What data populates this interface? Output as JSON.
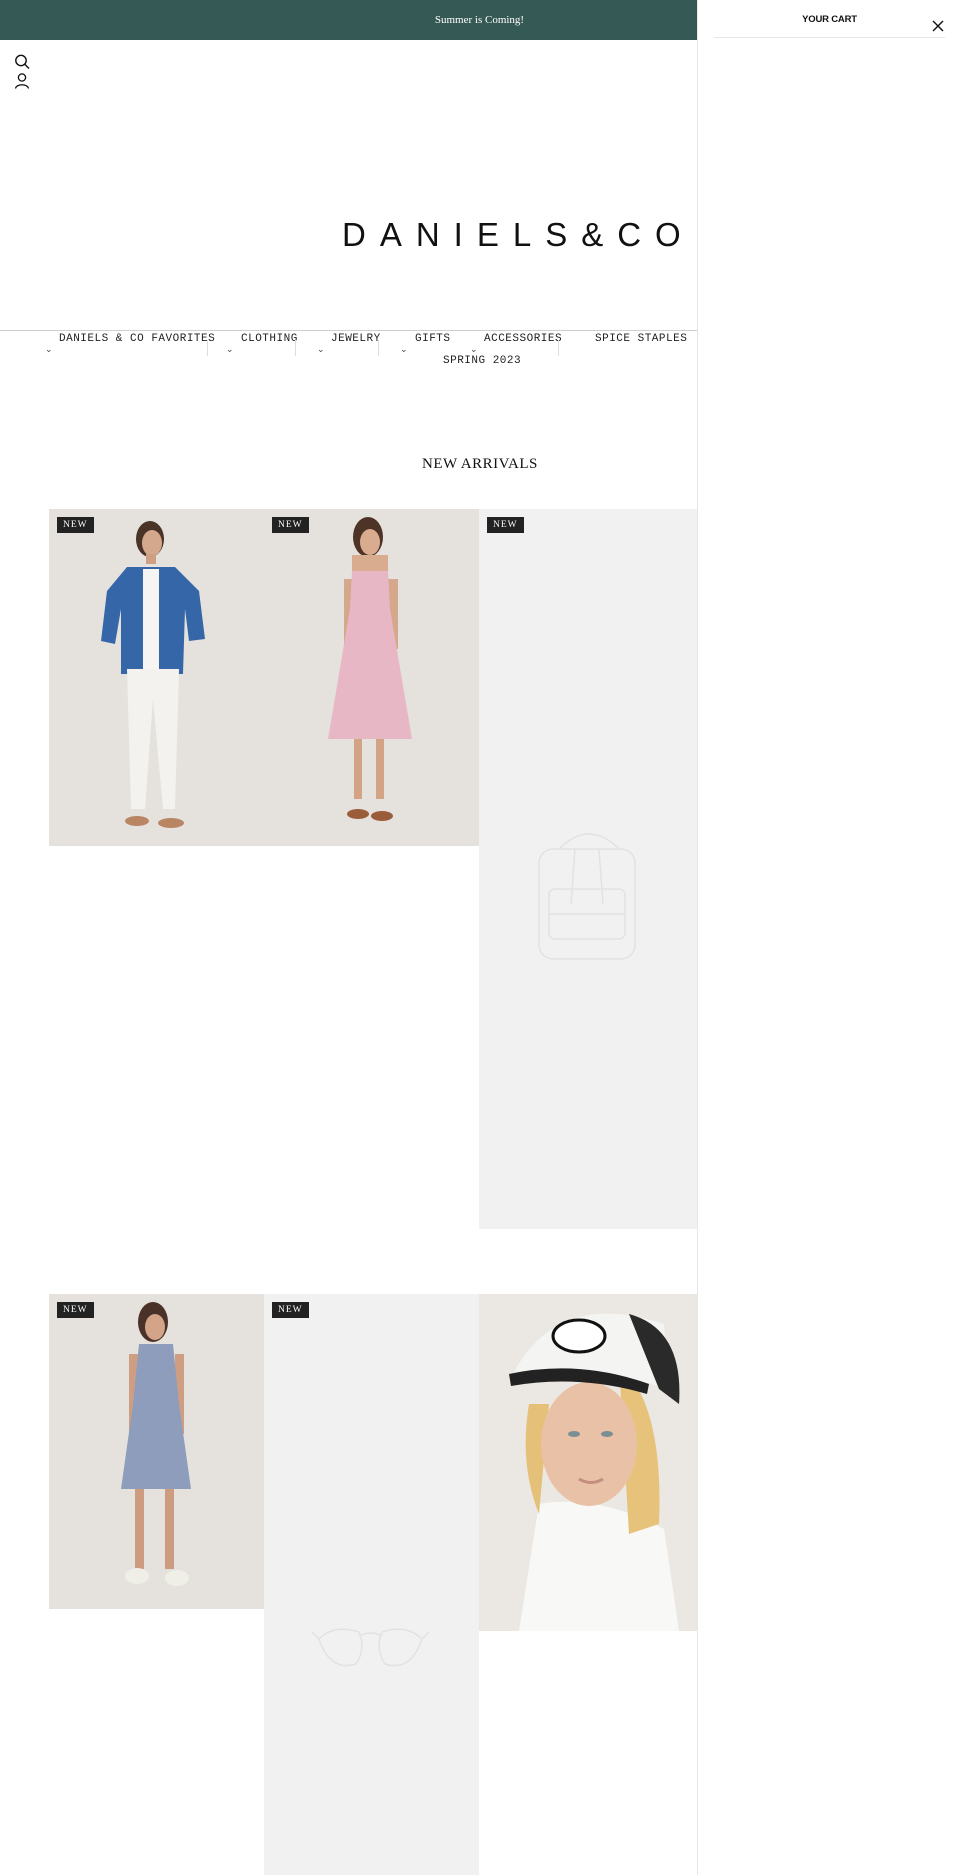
{
  "announcement": "Summer is Coming!",
  "logo": "DANIELS&CO",
  "header_icons": [
    "search-icon",
    "account-icon"
  ],
  "nav": [
    {
      "label": "DANIELS & CO FAVORITES",
      "has_dropdown": true
    },
    {
      "label": "CLOTHING",
      "has_dropdown": true
    },
    {
      "label": "JEWELRY",
      "has_dropdown": true
    },
    {
      "label": "GIFTS",
      "has_dropdown": true
    },
    {
      "label": "ACCESSORIES",
      "has_dropdown": true
    },
    {
      "label": "SPICE STAPLES",
      "has_dropdown": false
    },
    {
      "label": "SPRING 2023",
      "has_dropdown": false
    }
  ],
  "section_title": "NEW ARRIVALS",
  "badge_label": "NEW",
  "products": [
    {
      "image": "woman-blue-shirt-white-pants",
      "badge": true
    },
    {
      "image": "woman-pink-midi-dress",
      "badge": true
    },
    {
      "image": "placeholder-backpack-icon",
      "badge": true
    },
    {
      "image": "woman-blue-grey-tank-dress",
      "badge": true
    },
    {
      "image": "placeholder-sunglasses-icon",
      "badge": true
    },
    {
      "image": "woman-good-vibes-trucker-hat",
      "badge": false
    }
  ],
  "cart": {
    "title": "YOUR CART",
    "close_icon": "close-icon"
  },
  "colors": {
    "announcement_bg": "#355955",
    "badge_bg": "#222222",
    "placeholder_bg": "#f1f1f1"
  }
}
